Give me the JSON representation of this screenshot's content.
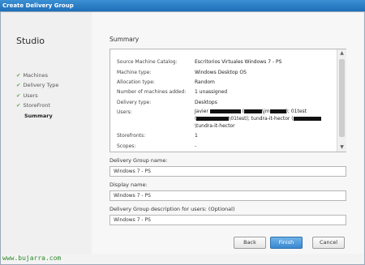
{
  "window": {
    "title": "Create Delivery Group"
  },
  "sidebar": {
    "brand": "Studio",
    "items": [
      {
        "label": "Machines",
        "done": true
      },
      {
        "label": "Delivery Type",
        "done": true
      },
      {
        "label": "Users",
        "done": true
      },
      {
        "label": "StoreFront",
        "done": true
      },
      {
        "label": "Summary",
        "done": false,
        "current": true
      }
    ]
  },
  "main": {
    "heading": "Summary",
    "summary": [
      {
        "label": "Source Machine Catalog:",
        "value": "Escritorios Virtuales Windows 7 - PS"
      },
      {
        "label": "Machine type:",
        "value": "Windows Desktop OS"
      },
      {
        "label": "Allocation type:",
        "value": "Random"
      },
      {
        "label": "Number of machines added:",
        "value": "1 unassigned"
      },
      {
        "label": "Delivery type:",
        "value": "Desktops"
      },
      {
        "label": "Users:",
        "value_lines": [
          "Javier",
          "\\01test); tundra-it-hector (",
          "\\tundra-it-hector"
        ],
        "fragments": [
          "(",
          "\\jm",
          "); 01test",
          "("
        ]
      },
      {
        "label": "Storefronts:",
        "value": "1"
      },
      {
        "label": "Scopes:",
        "value": "-"
      }
    ],
    "fields": [
      {
        "label": "Delivery Group name:",
        "value": "Windows 7 - PS"
      },
      {
        "label": "Display name:",
        "value": "Windows 7 - PS"
      },
      {
        "label": "Delivery Group description for users: (Optional)",
        "value": "Windows 7 - PS"
      }
    ]
  },
  "buttons": {
    "back": "Back",
    "finish": "Finish",
    "cancel": "Cancel"
  },
  "watermark": "www.bujarra.com",
  "icons": {
    "check": "checkmark-icon",
    "scroll_up": "arrow-up-icon",
    "scroll_down": "arrow-down-icon"
  },
  "colors": {
    "titlebar": "#2f7fc7",
    "primary_button": "#3a88cf",
    "check": "#6aa84f",
    "watermark": "#2b8a2b"
  }
}
